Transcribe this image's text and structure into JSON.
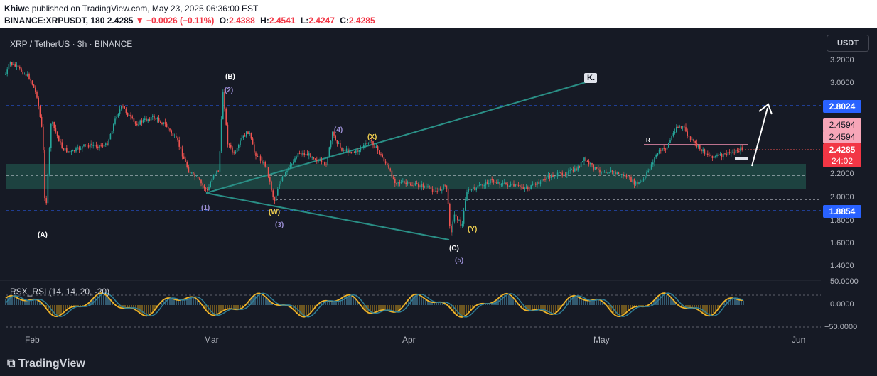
{
  "header": {
    "author": "Khiwe",
    "published_text": "published on TradingView.com, May 23, 2025 06:36:00 EST",
    "symbol": "BINANCE:XRPUSDT, 180",
    "last": "2.4285",
    "change": "−0.0026 (−0.11%)",
    "o_label": "O:",
    "o": "2.4388",
    "h_label": "H:",
    "h": "2.4541",
    "l_label": "L:",
    "l": "2.4247",
    "c_label": "C:",
    "c": "2.4285"
  },
  "chart_legend": "XRP / TetherUS · 3h · BINANCE",
  "currency_button": "USDT",
  "price_axis": [
    "3.2000",
    "3.0000",
    "2.2000",
    "2.0000",
    "1.8000",
    "1.6000",
    "1.4000"
  ],
  "price_badges": {
    "level_high": "2.8024",
    "level_low": "1.8854",
    "pink_1": "2.4594",
    "pink_2": "2.4594",
    "current": "2.4285",
    "countdown": "24:02"
  },
  "rsi": {
    "legend": "RSX_RSI (14, 14, 20, -20)",
    "axis": [
      "50.0000",
      "0.0000",
      "−50.0000"
    ]
  },
  "time_axis": [
    "Feb",
    "Mar",
    "Apr",
    "May",
    "Jun"
  ],
  "wave_labels": {
    "A": "(A)",
    "B": "(B)",
    "B2": "(2)",
    "W1": "(1)",
    "W": "(W)",
    "W3": "(3)",
    "W4": "(4)",
    "X": "(X)",
    "C": "(C)",
    "W5": "(5)",
    "Y": "(Y)",
    "K": "K.",
    "R": "R"
  },
  "footer": {
    "brand": "TradingView"
  },
  "colors": {
    "up": "#26a69a",
    "down": "#ef5350",
    "accent": "#2962ff",
    "zone": "#1f4a45",
    "yellow": "#f0d050",
    "purple": "#9c8fd6"
  }
}
